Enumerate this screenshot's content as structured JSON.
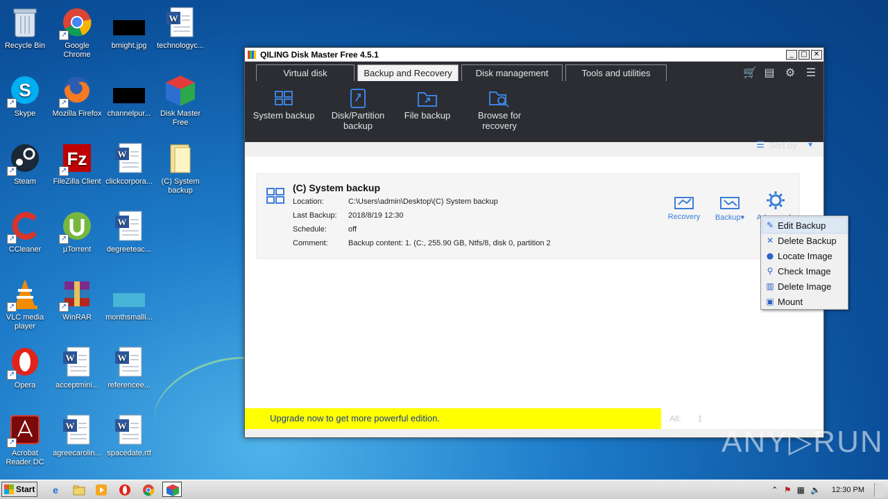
{
  "desktop": {
    "icons": [
      {
        "label": "Recycle Bin",
        "icon": "recycle-bin-icon"
      },
      {
        "label": "Google Chrome",
        "icon": "chrome-icon"
      },
      {
        "label": "bmight.jpg",
        "icon": "image-file-icon"
      },
      {
        "label": "technologyc...",
        "icon": "word-doc-icon"
      },
      {
        "label": "Skype",
        "icon": "skype-icon"
      },
      {
        "label": "Mozilla Firefox",
        "icon": "firefox-icon"
      },
      {
        "label": "channelpur...",
        "icon": "image-file-icon"
      },
      {
        "label": "Disk Master Free",
        "icon": "disk-master-icon"
      },
      {
        "label": "Steam",
        "icon": "steam-icon"
      },
      {
        "label": "FileZilla Client",
        "icon": "filezilla-icon"
      },
      {
        "label": "clickcorpora...",
        "icon": "word-doc-icon"
      },
      {
        "label": "(C) System backup",
        "icon": "folder-icon"
      },
      {
        "label": "CCleaner",
        "icon": "ccleaner-icon"
      },
      {
        "label": "µTorrent",
        "icon": "utorrent-icon"
      },
      {
        "label": "degreeteac...",
        "icon": "word-doc-icon"
      },
      {
        "label": "VLC media player",
        "icon": "vlc-icon"
      },
      {
        "label": "WinRAR",
        "icon": "winrar-icon"
      },
      {
        "label": "monthsmalli...",
        "icon": "image-file-icon"
      },
      {
        "label": "Opera",
        "icon": "opera-icon"
      },
      {
        "label": "acceptmini...",
        "icon": "word-doc-icon"
      },
      {
        "label": "referencee...",
        "icon": "word-doc-icon"
      },
      {
        "label": "Acrobat Reader DC",
        "icon": "acrobat-icon"
      },
      {
        "label": "agreecarolin...",
        "icon": "word-doc-icon"
      },
      {
        "label": "spacedate.rtf",
        "icon": "word-doc-icon"
      }
    ]
  },
  "window": {
    "title": "QILING Disk Master Free 4.5.1",
    "tabs": [
      {
        "label": "Virtual disk"
      },
      {
        "label": "Backup and Recovery"
      },
      {
        "label": "Disk management"
      },
      {
        "label": "Tools and utilities"
      }
    ],
    "toolbar": [
      {
        "label": "System backup"
      },
      {
        "label": "Disk/Partition backup"
      },
      {
        "label": "File backup"
      },
      {
        "label": "Browse for recovery"
      }
    ],
    "sort_label": "Sort by",
    "card": {
      "title": "(C) System backup",
      "rows": [
        {
          "key": "Location:",
          "value": "C:\\Users\\admin\\Desktop\\(C) System backup"
        },
        {
          "key": "Last Backup:",
          "value": "2018/8/19 12:30"
        },
        {
          "key": "Schedule:",
          "value": "off"
        },
        {
          "key": "Comment:",
          "value": "Backup content:  1. (C:, 255.90 GB, Ntfs/8, disk 0, partition 2"
        }
      ],
      "actions": [
        {
          "label": "Recovery"
        },
        {
          "label": "Backup▾"
        },
        {
          "label": "Advanced▾"
        }
      ]
    },
    "upgrade_text": "Upgrade now to get more powerful edition.",
    "all_label": "All:",
    "all_count": "1"
  },
  "context_menu": {
    "items": [
      {
        "label": "Edit Backup"
      },
      {
        "label": "Delete Backup"
      },
      {
        "label": "Locate Image"
      },
      {
        "label": "Check Image"
      },
      {
        "label": "Delete Image"
      },
      {
        "label": "Mount"
      }
    ]
  },
  "watermark": "ANY▷RUN",
  "taskbar": {
    "start_label": "Start",
    "clock": "12:30 PM"
  },
  "colors": {
    "accent_blue": "#3b7dd8",
    "dark_panel": "#2b2d33",
    "upgrade_bar": "#ffff00"
  }
}
